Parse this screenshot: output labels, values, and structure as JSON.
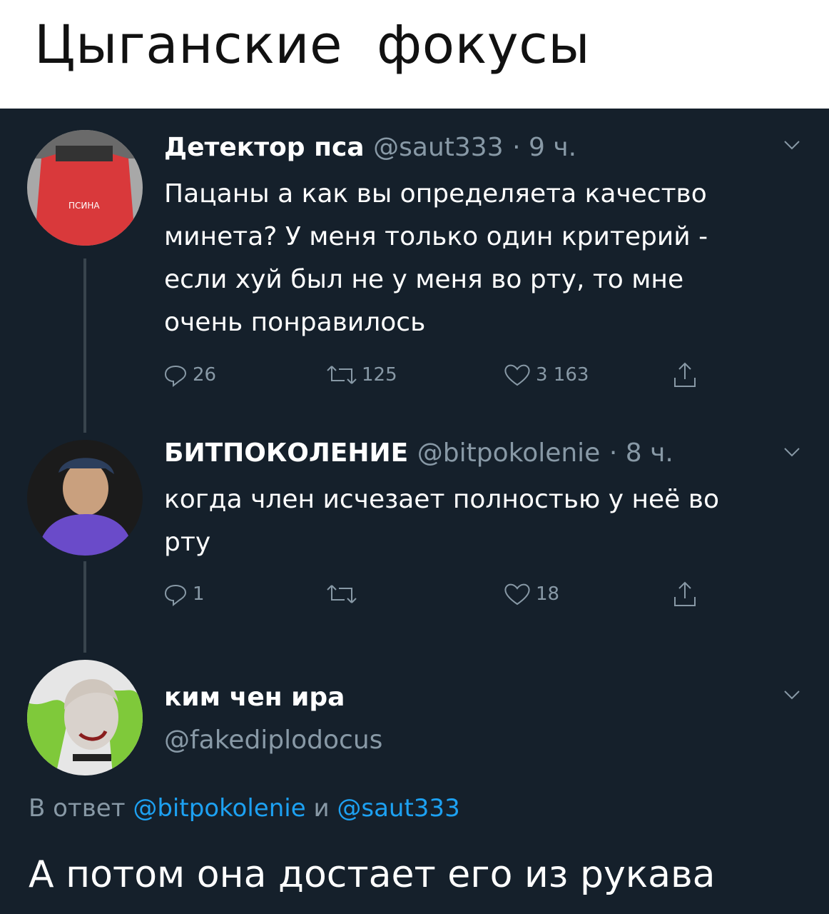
{
  "caption": {
    "title": "Цыганские  фокусы"
  },
  "theme": {
    "background": "#15202b",
    "text": "#ffffff",
    "secondary": "#8899a6",
    "link": "#1da1f2",
    "line": "#38444d"
  },
  "tweets": [
    {
      "name": "Детектор пса",
      "handle": "@saut333",
      "time": "· 9 ч.",
      "avatar_icon": "avatar-red-shirt",
      "lines": [
        "Пацаны а как вы определяета качество",
        "минета? У меня только один критерий -",
        "если хуй был не у меня во рту, то мне",
        "очень понравилось"
      ],
      "actions": {
        "replies": "26",
        "retweets": "125",
        "likes": "3 163"
      }
    },
    {
      "name": "БИТПОКОЛЕНИЕ",
      "handle": "@bitpokolenie",
      "time": "· 8 ч.",
      "avatar_icon": "avatar-man-cap",
      "lines": [
        "когда член исчезает полностью у неё во",
        "рту"
      ],
      "actions": {
        "replies": "1",
        "retweets": "",
        "likes": "18"
      }
    },
    {
      "name": "ким чен ира",
      "handle": "@fakediplodocus",
      "avatar_icon": "avatar-illustration"
    }
  ],
  "reply_context": {
    "prefix": "В ответ",
    "mention1": "@bitpokolenie",
    "joiner": "и",
    "mention2": "@saut333"
  },
  "final_tweet": {
    "text": "А потом она достает его из рукава"
  }
}
